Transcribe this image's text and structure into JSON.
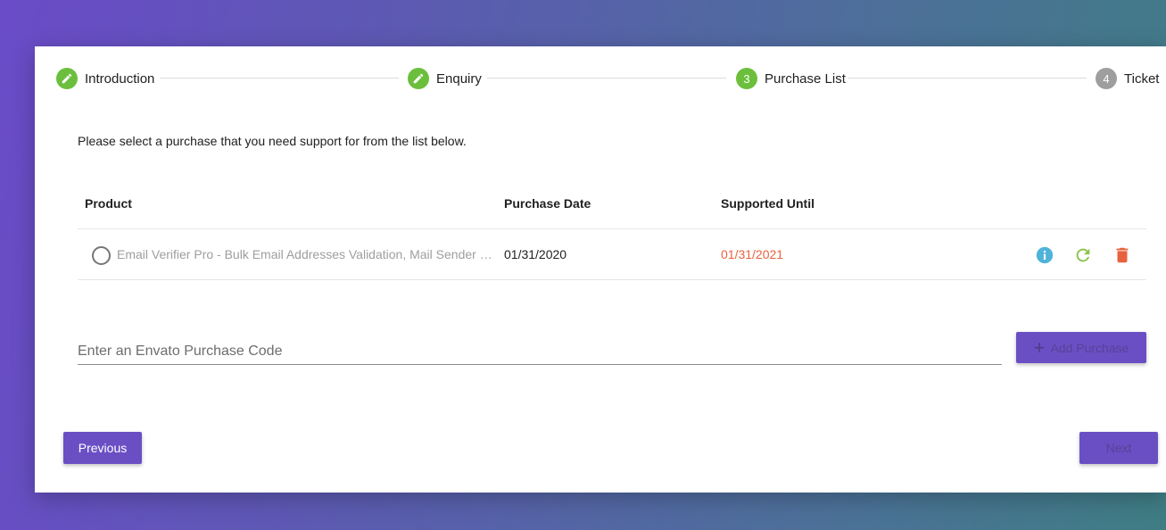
{
  "stepper": {
    "steps": [
      {
        "number": "",
        "label": "Introduction",
        "state": "done",
        "icon": "pencil-icon"
      },
      {
        "number": "",
        "label": "Enquiry",
        "state": "done",
        "icon": "pencil-icon"
      },
      {
        "number": "3",
        "label": "Purchase List",
        "state": "active"
      },
      {
        "number": "4",
        "label": "Ticket",
        "state": "pending"
      }
    ]
  },
  "description": "Please select a purchase that you need support for from the list below.",
  "table": {
    "headers": {
      "product": "Product",
      "purchase_date": "Purchase Date",
      "supported_until": "Supported Until"
    },
    "rows": [
      {
        "product": "Email Verifier Pro - Bulk Email Addresses Validation, Mail Sender & Email List Cleaner Script",
        "purchase_date": "01/31/2020",
        "supported_until": "01/31/2021",
        "actions": [
          "info-icon",
          "refresh-icon",
          "trash-icon"
        ]
      }
    ]
  },
  "purchase_code": {
    "placeholder": "Enter an Envato Purchase Code",
    "value": ""
  },
  "buttons": {
    "add_purchase": "Add Purchase",
    "previous": "Previous",
    "next": "Next"
  },
  "colors": {
    "accent": "#6a4fc4",
    "step_done": "#6cbf3c",
    "step_pending": "#9e9e9e",
    "expired_date": "#e8623f",
    "info_icon": "#4fb3d9",
    "refresh_icon": "#8bc34a",
    "trash_icon": "#e8623f"
  }
}
